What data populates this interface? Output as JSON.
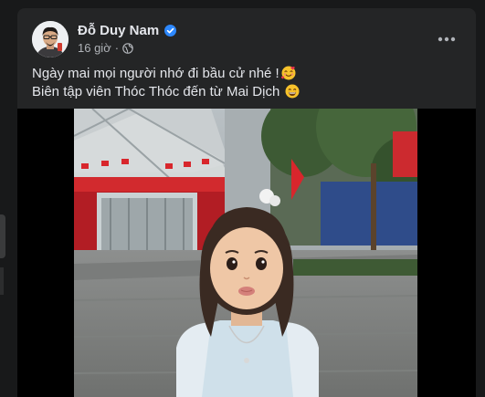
{
  "post": {
    "author": "Đỗ Duy Nam",
    "time": "16 giờ",
    "separator": "·",
    "verified": true,
    "lines": [
      "Ngày mai mọi người nhớ đi bầu cử nhé !",
      "Biên tập viên Thóc Thóc đến từ Mai Dịch"
    ],
    "emojis": [
      "smiling-face-with-hearts",
      "grinning-face"
    ]
  },
  "icons": {
    "verified": "verified-badge-icon",
    "audience": "globe-icon",
    "more": "more-options-icon"
  },
  "colors": {
    "background": "#18191a",
    "card": "#242526",
    "text": "#e4e6eb",
    "secondary": "#b0b3b8",
    "verified": "#2d88ff"
  }
}
